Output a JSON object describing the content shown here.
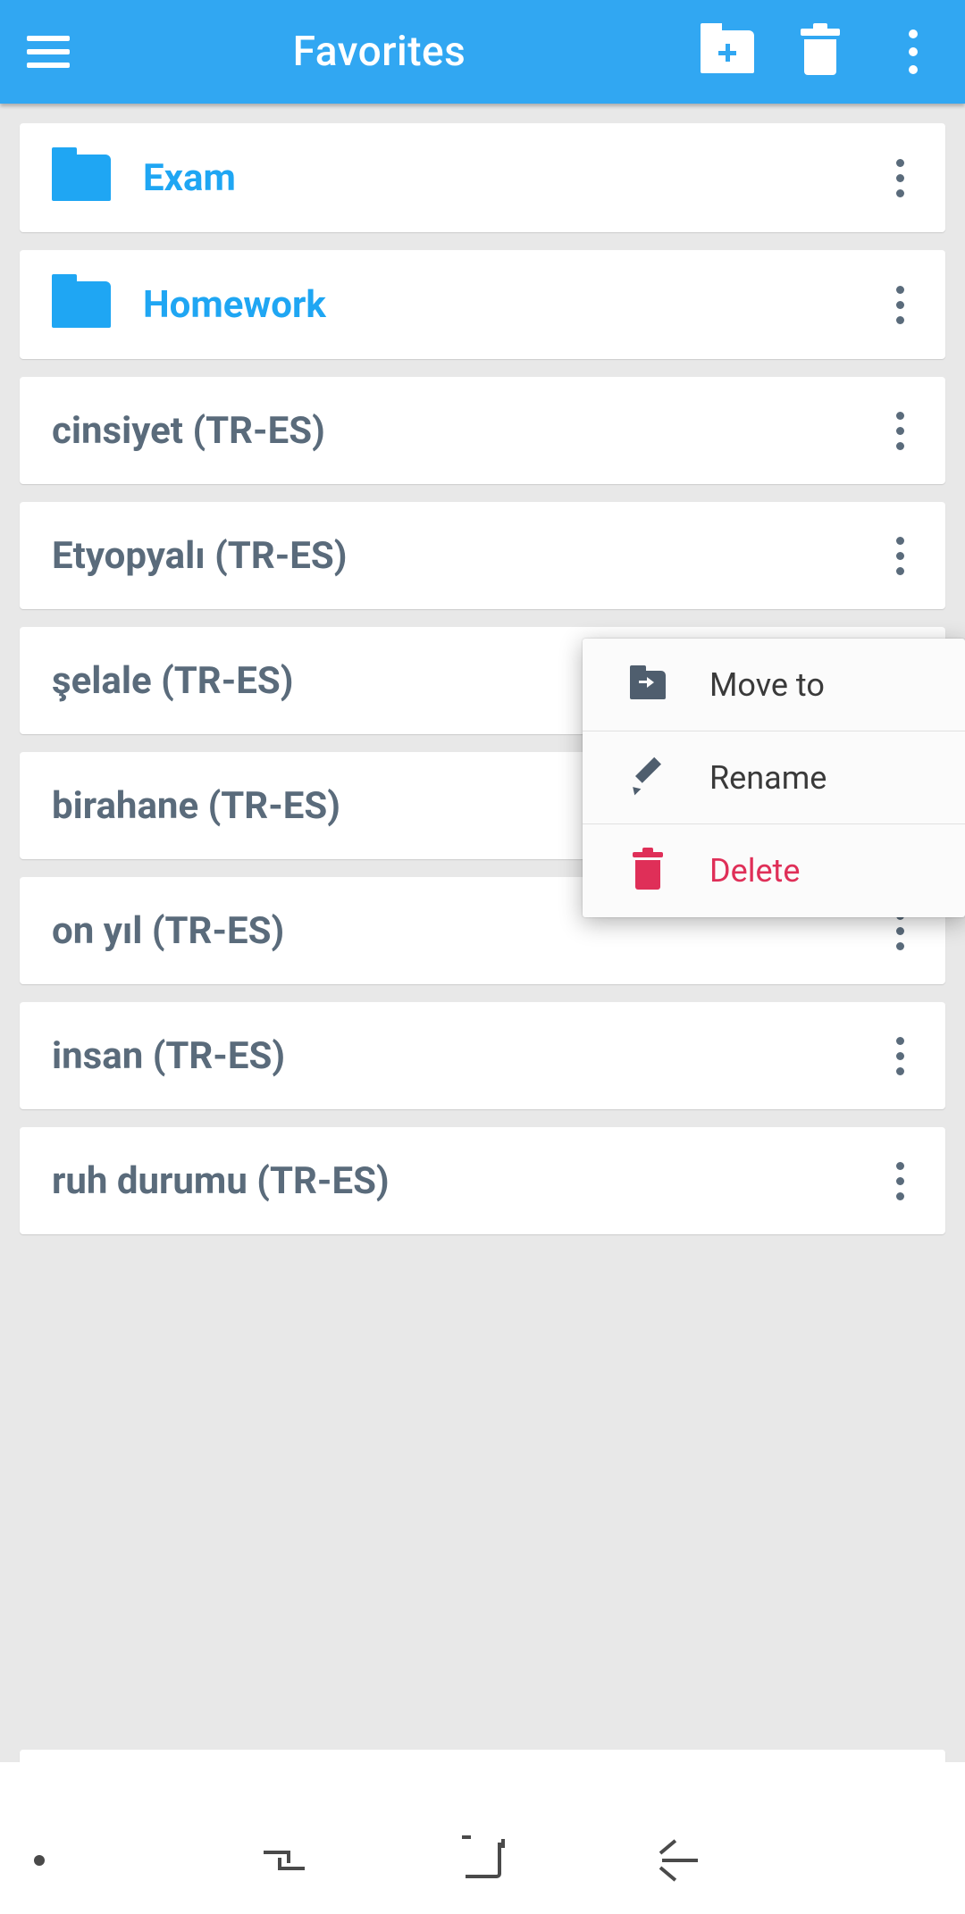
{
  "header": {
    "title": "Favorites"
  },
  "folders": [
    {
      "label": "Exam"
    },
    {
      "label": "Homework"
    }
  ],
  "words": [
    {
      "label": "cinsiyet (TR-ES)"
    },
    {
      "label": "Etyopyalı (TR-ES)"
    },
    {
      "label": "şelale (TR-ES)"
    },
    {
      "label": "birahane (TR-ES)"
    },
    {
      "label": "on yıl (TR-ES)"
    },
    {
      "label": "insan (TR-ES)"
    },
    {
      "label": "ruh durumu (TR-ES)"
    }
  ],
  "popup": {
    "move": "Move to",
    "rename": "Rename",
    "delete": "Delete"
  }
}
